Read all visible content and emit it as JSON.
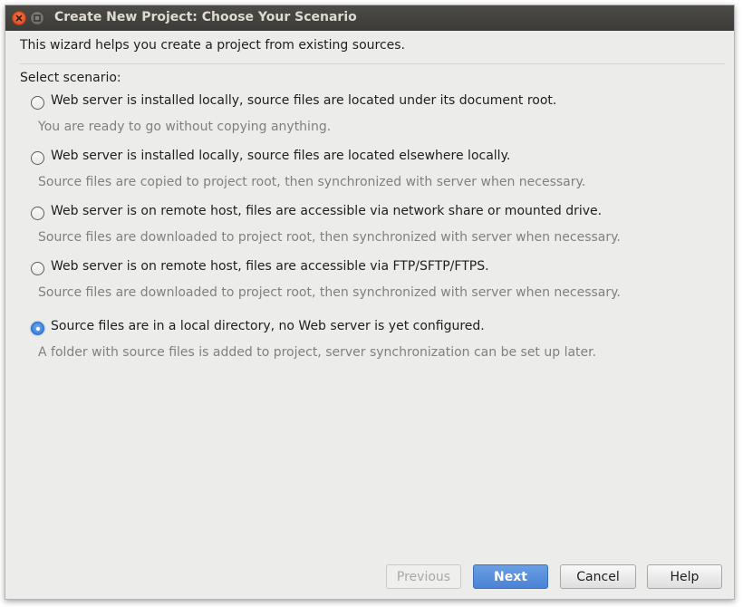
{
  "window": {
    "title": "Create New Project: Choose Your Scenario"
  },
  "intro": "This wizard helps you create a project from existing sources.",
  "select_label": "Select scenario:",
  "scenarios": [
    {
      "label": "Web server is installed locally, source files are located under its document root.",
      "description": "You are ready to go without copying anything.",
      "selected": false
    },
    {
      "label": "Web server is installed locally, source files are located elsewhere locally.",
      "description": "Source files are copied to project root, then synchronized with server when necessary.",
      "selected": false
    },
    {
      "label": "Web server is on remote host, files are accessible via network share or mounted drive.",
      "description": "Source files are downloaded to project root, then synchronized with server when necessary.",
      "selected": false
    },
    {
      "label": "Web server is on remote host, files are accessible via FTP/SFTP/FTPS.",
      "description": "Source files are downloaded to project root, then synchronized with server when necessary.",
      "selected": false
    },
    {
      "label": "Source files are in a local directory, no Web server is yet configured.",
      "description": "A folder with source files is added to project, server synchronization can be set up later.",
      "selected": true
    }
  ],
  "buttons": {
    "previous": "Previous",
    "next": "Next",
    "cancel": "Cancel",
    "help": "Help"
  },
  "icons": {
    "close": "close-icon",
    "minimize": "minimize-icon"
  },
  "colors": {
    "accent": "#4a82d6",
    "titlebar": "#3c3b37",
    "close_button": "#e65e2d"
  }
}
